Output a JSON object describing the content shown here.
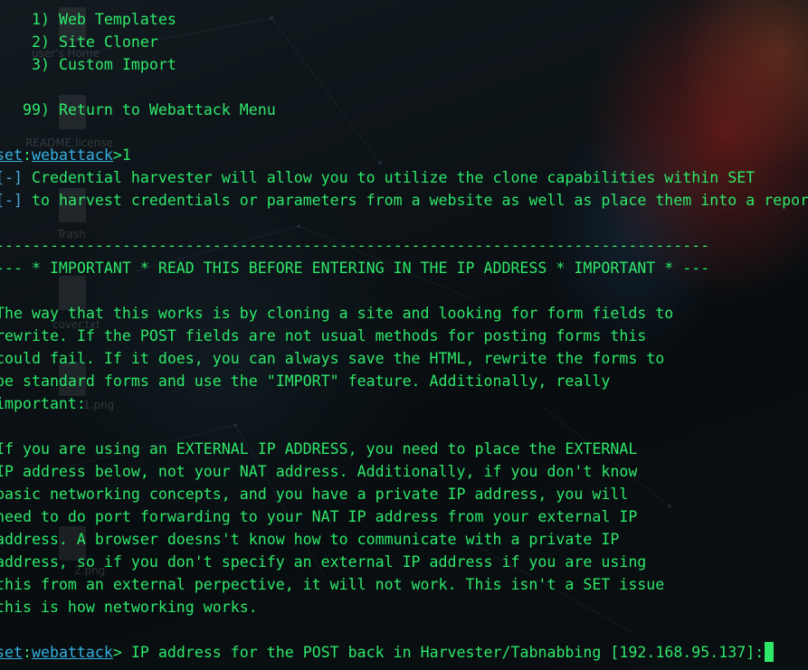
{
  "menu": {
    "items": [
      {
        "number": "1)",
        "label": "Web Templates"
      },
      {
        "number": "2)",
        "label": "Site Cloner"
      },
      {
        "number": "3)",
        "label": "Custom Import"
      }
    ],
    "return_item": {
      "number": "99)",
      "label": "Return to Webattack Menu"
    }
  },
  "prompt1": {
    "prefix": "set",
    "separator": ":",
    "module": "webattack",
    "marker": ">",
    "input": "1"
  },
  "info": {
    "marker": "[-]",
    "lines": [
      "Credential harvester will allow you to utilize the clone capabilities within SET",
      "to harvest credentials or parameters from a website as well as place them into a report"
    ]
  },
  "important": {
    "divider": "-------------------------------------------------------------------------------",
    "heading": "--- * IMPORTANT * READ THIS BEFORE ENTERING IN THE IP ADDRESS * IMPORTANT * ---"
  },
  "paragraph1": [
    "The way that this works is by cloning a site and looking for form fields to",
    "rewrite. If the POST fields are not usual methods for posting forms this",
    "could fail. If it does, you can always save the HTML, rewrite the forms to",
    "be standard forms and use the \"IMPORT\" feature. Additionally, really",
    "important:"
  ],
  "paragraph2": [
    "If you are using an EXTERNAL IP ADDRESS, you need to place the EXTERNAL",
    "IP address below, not your NAT address. Additionally, if you don't know",
    "basic networking concepts, and you have a private IP address, you will",
    "need to do port forwarding to your NAT IP address from your external IP",
    "address. A browser doesns't know how to communicate with a private IP",
    "address, so if you don't specify an external IP address if you are using",
    "this from an external perpective, it will not work. This isn't a SET issue",
    "this is how networking works."
  ],
  "prompt2": {
    "prefix": "set",
    "separator": ":",
    "module": "webattack",
    "marker": ">",
    "question": " IP address for the POST back in Harvester/Tabnabbing [192.168.95.137]:"
  },
  "desktop": {
    "icons": [
      {
        "icon": "folder-icon",
        "label": "user's Home"
      },
      {
        "icon": "file-icon",
        "label": "README.license"
      },
      {
        "icon": "trash-icon",
        "label": "Trash"
      },
      {
        "icon": "file-icon",
        "label": "cover.txt"
      },
      {
        "icon": "image-icon",
        "label": "1.png"
      },
      {
        "icon": "image-icon",
        "label": "2.png"
      }
    ]
  },
  "colors": {
    "terminal_text": "#2ee86a",
    "prompt_accent": "#35aede",
    "background": "#0b1114"
  }
}
